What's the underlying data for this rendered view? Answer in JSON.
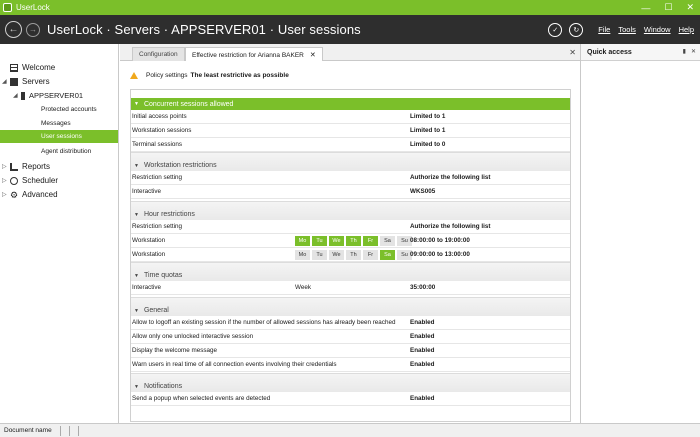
{
  "window": {
    "title": "UserLock",
    "controls": {
      "minimize": "—",
      "maximize": "☐",
      "close": "✕"
    }
  },
  "header": {
    "breadcrumb": "UserLock · Servers · APPSERVER01 · User sessions",
    "menu": [
      "File",
      "Tools",
      "Window",
      "Help"
    ]
  },
  "sidebar": {
    "items": [
      {
        "label": "Welcome"
      },
      {
        "label": "Servers"
      },
      {
        "label": "APPSERVER01"
      },
      {
        "label": "Protected accounts"
      },
      {
        "label": "Messages"
      },
      {
        "label": "User sessions"
      },
      {
        "label": "Agent distribution"
      },
      {
        "label": "Reports"
      },
      {
        "label": "Scheduler"
      },
      {
        "label": "Advanced"
      }
    ]
  },
  "tabs": [
    {
      "label": "Configuration"
    },
    {
      "label": "Effective restriction for  Arianna BAKER"
    }
  ],
  "policy": {
    "label": "Policy settings",
    "value": "The least restrictive as possible"
  },
  "sections": {
    "concurrent": {
      "title": "Concurrent sessions allowed",
      "rows": [
        {
          "name": "Initial access points",
          "value": "Limited to 1"
        },
        {
          "name": "Workstation sessions",
          "value": "Limited to 1"
        },
        {
          "name": "Terminal sessions",
          "value": "Limited to 0"
        }
      ]
    },
    "workstation": {
      "title": "Workstation restrictions",
      "rows": [
        {
          "name": "Restriction setting",
          "value": "Authorize the following list"
        },
        {
          "name": "Interactive",
          "value": "WKS005"
        }
      ]
    },
    "hour": {
      "title": "Hour restrictions",
      "rows": [
        {
          "name": "Restriction setting",
          "value": "Authorize the following list"
        },
        {
          "name": "Workstation",
          "value": "08:00:00 to 19:00:00",
          "days_active": [
            true,
            true,
            true,
            true,
            true,
            false,
            false
          ]
        },
        {
          "name": "Workstation",
          "value": "09:00:00 to 13:00:00",
          "days_active": [
            false,
            false,
            false,
            false,
            false,
            true,
            false
          ]
        }
      ],
      "days": [
        "Mo",
        "Tu",
        "We",
        "Th",
        "Fr",
        "Sa",
        "Su"
      ]
    },
    "quotas": {
      "title": "Time quotas",
      "rows": [
        {
          "name": "Interactive",
          "period": "Week",
          "value": "35:00:00"
        }
      ]
    },
    "general": {
      "title": "General",
      "rows": [
        {
          "name": "Allow to logoff an existing session if the number of allowed sessions has already been reached",
          "value": "Enabled"
        },
        {
          "name": "Allow only one unlocked interactive session",
          "value": "Enabled"
        },
        {
          "name": "Display the welcome message",
          "value": "Enabled"
        },
        {
          "name": "Warn users in real time of all connection events involving their credentials",
          "value": "Enabled"
        }
      ]
    },
    "notifications": {
      "title": "Notifications",
      "rows": [
        {
          "name": "Send a popup when selected events are detected",
          "value": "Enabled"
        }
      ]
    }
  },
  "quick_access": {
    "title": "Quick access"
  },
  "statusbar": {
    "document": "Document name"
  },
  "colors": {
    "accent": "#7bbf2a",
    "header_bg": "#2e2e2e",
    "warning": "#f0a81c"
  }
}
